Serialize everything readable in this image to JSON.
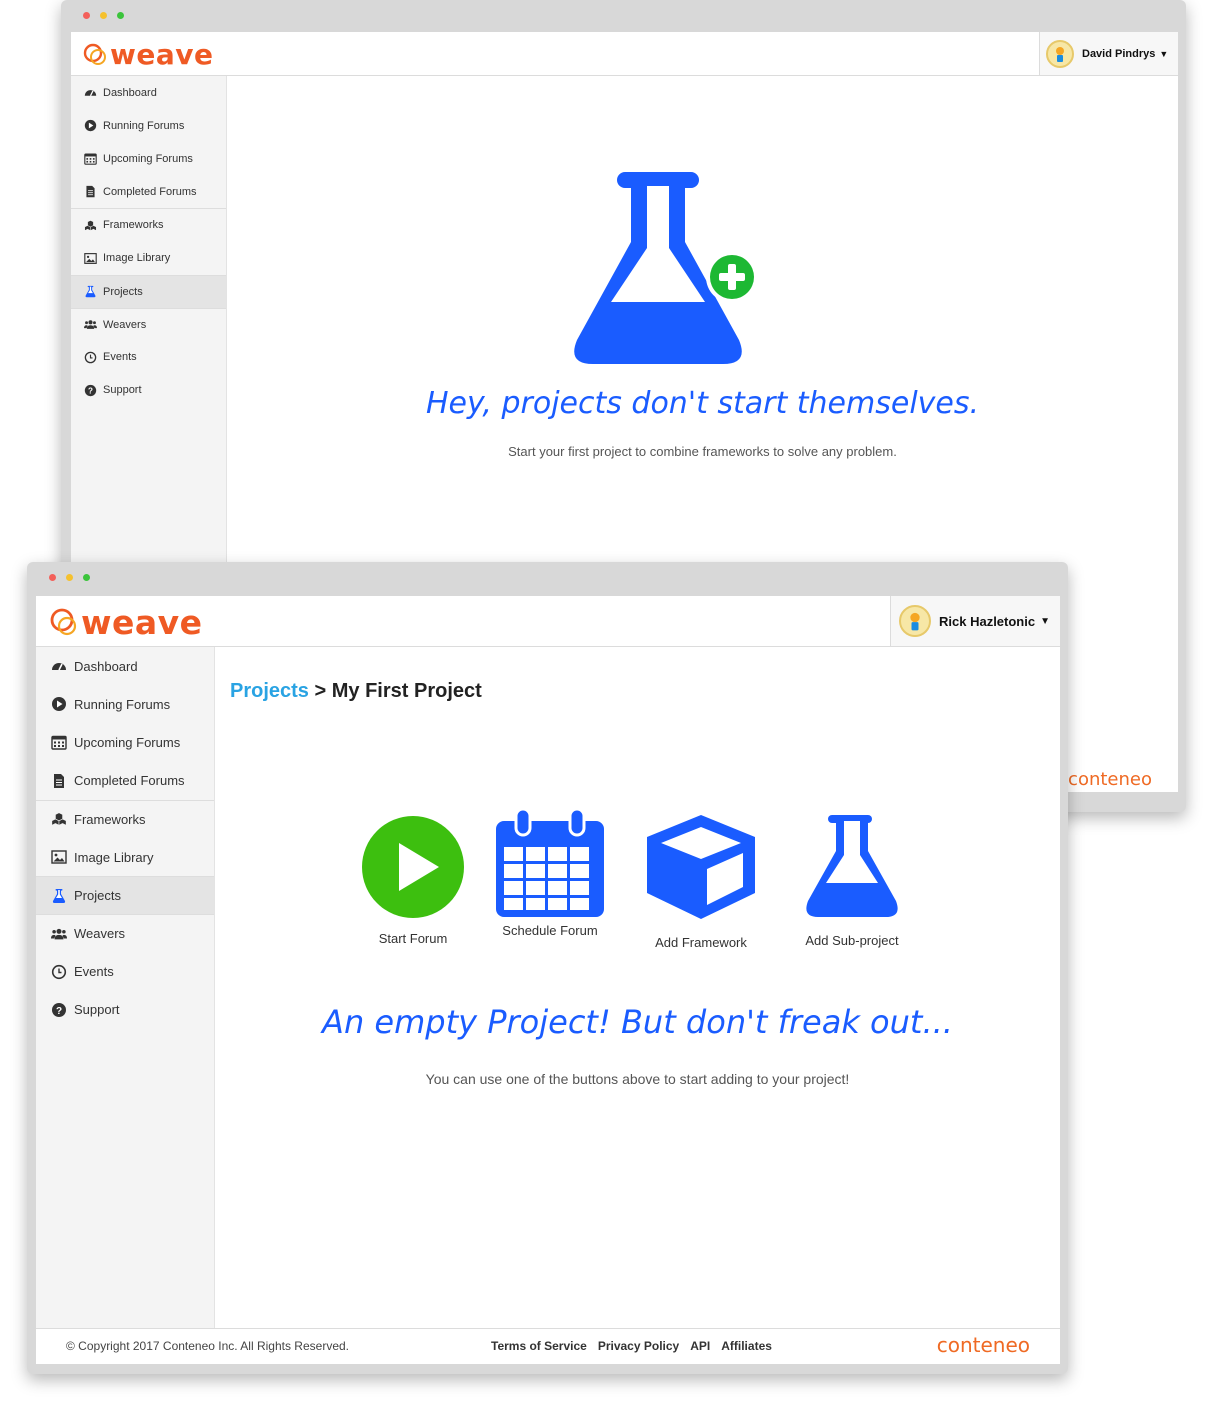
{
  "back_window": {
    "brand": "weave",
    "user_name": "David Pindrys",
    "nav": [
      {
        "label": "Dashboard",
        "icon": "dashboard-icon"
      },
      {
        "label": "Running Forums",
        "icon": "play-circle-icon"
      },
      {
        "label": "Upcoming Forums",
        "icon": "calendar-icon"
      },
      {
        "label": "Completed Forums",
        "icon": "document-icon"
      },
      {
        "label": "Frameworks",
        "icon": "cubes-icon"
      },
      {
        "label": "Image Library",
        "icon": "image-icon"
      },
      {
        "label": "Projects",
        "icon": "flask-icon"
      },
      {
        "label": "Weavers",
        "icon": "users-icon"
      },
      {
        "label": "Events",
        "icon": "clock-icon"
      },
      {
        "label": "Support",
        "icon": "question-icon"
      }
    ],
    "empty_title": "Hey, projects don't start themselves.",
    "empty_subtitle": "Start your first project to combine frameworks to solve any problem.",
    "footer_brand": "conteneo"
  },
  "front_window": {
    "brand": "weave",
    "user_name": "Rick Hazletonic",
    "nav": [
      {
        "label": "Dashboard",
        "icon": "dashboard-icon"
      },
      {
        "label": "Running Forums",
        "icon": "play-circle-icon"
      },
      {
        "label": "Upcoming Forums",
        "icon": "calendar-icon"
      },
      {
        "label": "Completed Forums",
        "icon": "document-icon"
      },
      {
        "label": "Frameworks",
        "icon": "cubes-icon"
      },
      {
        "label": "Image Library",
        "icon": "image-icon"
      },
      {
        "label": "Projects",
        "icon": "flask-icon"
      },
      {
        "label": "Weavers",
        "icon": "users-icon"
      },
      {
        "label": "Events",
        "icon": "clock-icon"
      },
      {
        "label": "Support",
        "icon": "question-icon"
      }
    ],
    "breadcrumb": {
      "link": "Projects",
      "separator": ">",
      "current": "My First Project"
    },
    "actions": [
      {
        "label": "Start Forum",
        "icon": "play-circle-icon"
      },
      {
        "label": "Schedule Forum",
        "icon": "calendar-icon"
      },
      {
        "label": "Add Framework",
        "icon": "cube-icon"
      },
      {
        "label": "Add Sub-project",
        "icon": "flask-icon"
      }
    ],
    "empty_title": "An empty Project! But don't freak out...",
    "empty_subtitle": "You can use one of the buttons above to start adding to your project!",
    "footer": {
      "copyright": "© Copyright 2017 Conteneo Inc. All Rights Reserved.",
      "links": [
        "Terms of Service",
        "Privacy Policy",
        "API",
        "Affiliates"
      ],
      "brand": "conteneo"
    }
  },
  "colors": {
    "accent_blue": "#1a5cff",
    "link_blue": "#29a3e3",
    "brand_orange": "#ef5a24",
    "play_green": "#3dbf0f",
    "plus_green": "#1db833"
  }
}
